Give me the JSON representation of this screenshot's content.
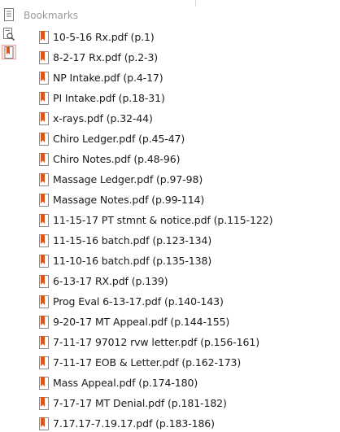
{
  "panel": {
    "title": "Bookmarks"
  },
  "tools": [
    {
      "name": "page-list-icon",
      "active": false
    },
    {
      "name": "search-pages-icon",
      "active": false
    },
    {
      "name": "bookmark-panel-icon",
      "active": true
    }
  ],
  "colors": {
    "bookmark_icon": "#d9571c",
    "active_tool_bg": "#fde9e5",
    "title_text": "#9b9b9b"
  },
  "bookmarks": [
    {
      "label": "10-5-16 Rx.pdf (p.1)"
    },
    {
      "label": "8-2-17 Rx.pdf (p.2-3)"
    },
    {
      "label": "NP Intake.pdf (p.4-17)"
    },
    {
      "label": "PI Intake.pdf (p.18-31)"
    },
    {
      "label": "x-rays.pdf (p.32-44)"
    },
    {
      "label": "Chiro Ledger.pdf (p.45-47)"
    },
    {
      "label": "Chiro Notes.pdf (p.48-96)"
    },
    {
      "label": "Massage Ledger.pdf (p.97-98)"
    },
    {
      "label": "Massage Notes.pdf (p.99-114)"
    },
    {
      "label": "11-15-17 PT stmnt & notice.pdf (p.115-122)"
    },
    {
      "label": "11-15-16 batch.pdf (p.123-134)"
    },
    {
      "label": "11-10-16 batch.pdf (p.135-138)"
    },
    {
      "label": "6-13-17 RX.pdf (p.139)"
    },
    {
      "label": "Prog Eval 6-13-17.pdf (p.140-143)"
    },
    {
      "label": "9-20-17 MT Appeal.pdf (p.144-155)"
    },
    {
      "label": "7-11-17 97012 rvw letter.pdf (p.156-161)"
    },
    {
      "label": "7-11-17 EOB & Letter.pdf (p.162-173)"
    },
    {
      "label": "Mass Appeal.pdf (p.174-180)"
    },
    {
      "label": "7-17-17 MT Denial.pdf (p.181-182)"
    },
    {
      "label": "7.17.17-7.19.17.pdf (p.183-186)"
    }
  ]
}
